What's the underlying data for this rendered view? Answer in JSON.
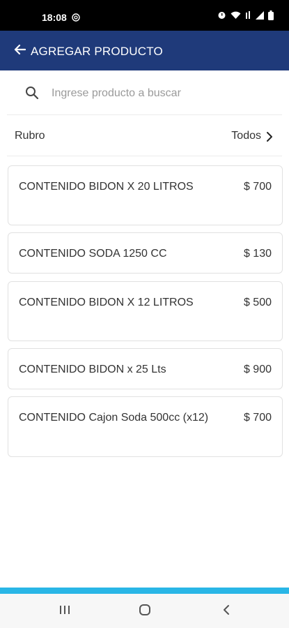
{
  "status_bar": {
    "time": "18:08",
    "icons": [
      "at-icon",
      "alarm-icon",
      "wifi-icon",
      "volte-icon",
      "signal-icon",
      "battery-icon"
    ]
  },
  "app_bar": {
    "title": "AGREGAR PRODUCTO",
    "back_icon": "arrow-left-icon",
    "background": "#1f3a7a"
  },
  "search": {
    "placeholder": "Ingrese producto a buscar",
    "value": ""
  },
  "filter": {
    "label": "Rubro",
    "value": "Todos"
  },
  "products": [
    {
      "name": "CONTENIDO BIDON X 20 LITROS",
      "price": "$ 700"
    },
    {
      "name": "CONTENIDO SODA 1250 CC",
      "price": "$ 130"
    },
    {
      "name": "CONTENIDO BIDON X 12 LITROS",
      "price": "$ 500"
    },
    {
      "name": "CONTENIDO BIDON x 25 Lts",
      "price": "$ 900"
    },
    {
      "name": "CONTENIDO Cajon Soda 500cc (x12)",
      "price": "$ 700"
    }
  ],
  "colors": {
    "accent": "#29b6e6",
    "header": "#1f3a7a"
  },
  "nav_bar": {
    "buttons": [
      "recents-icon",
      "home-icon",
      "back-icon"
    ]
  }
}
